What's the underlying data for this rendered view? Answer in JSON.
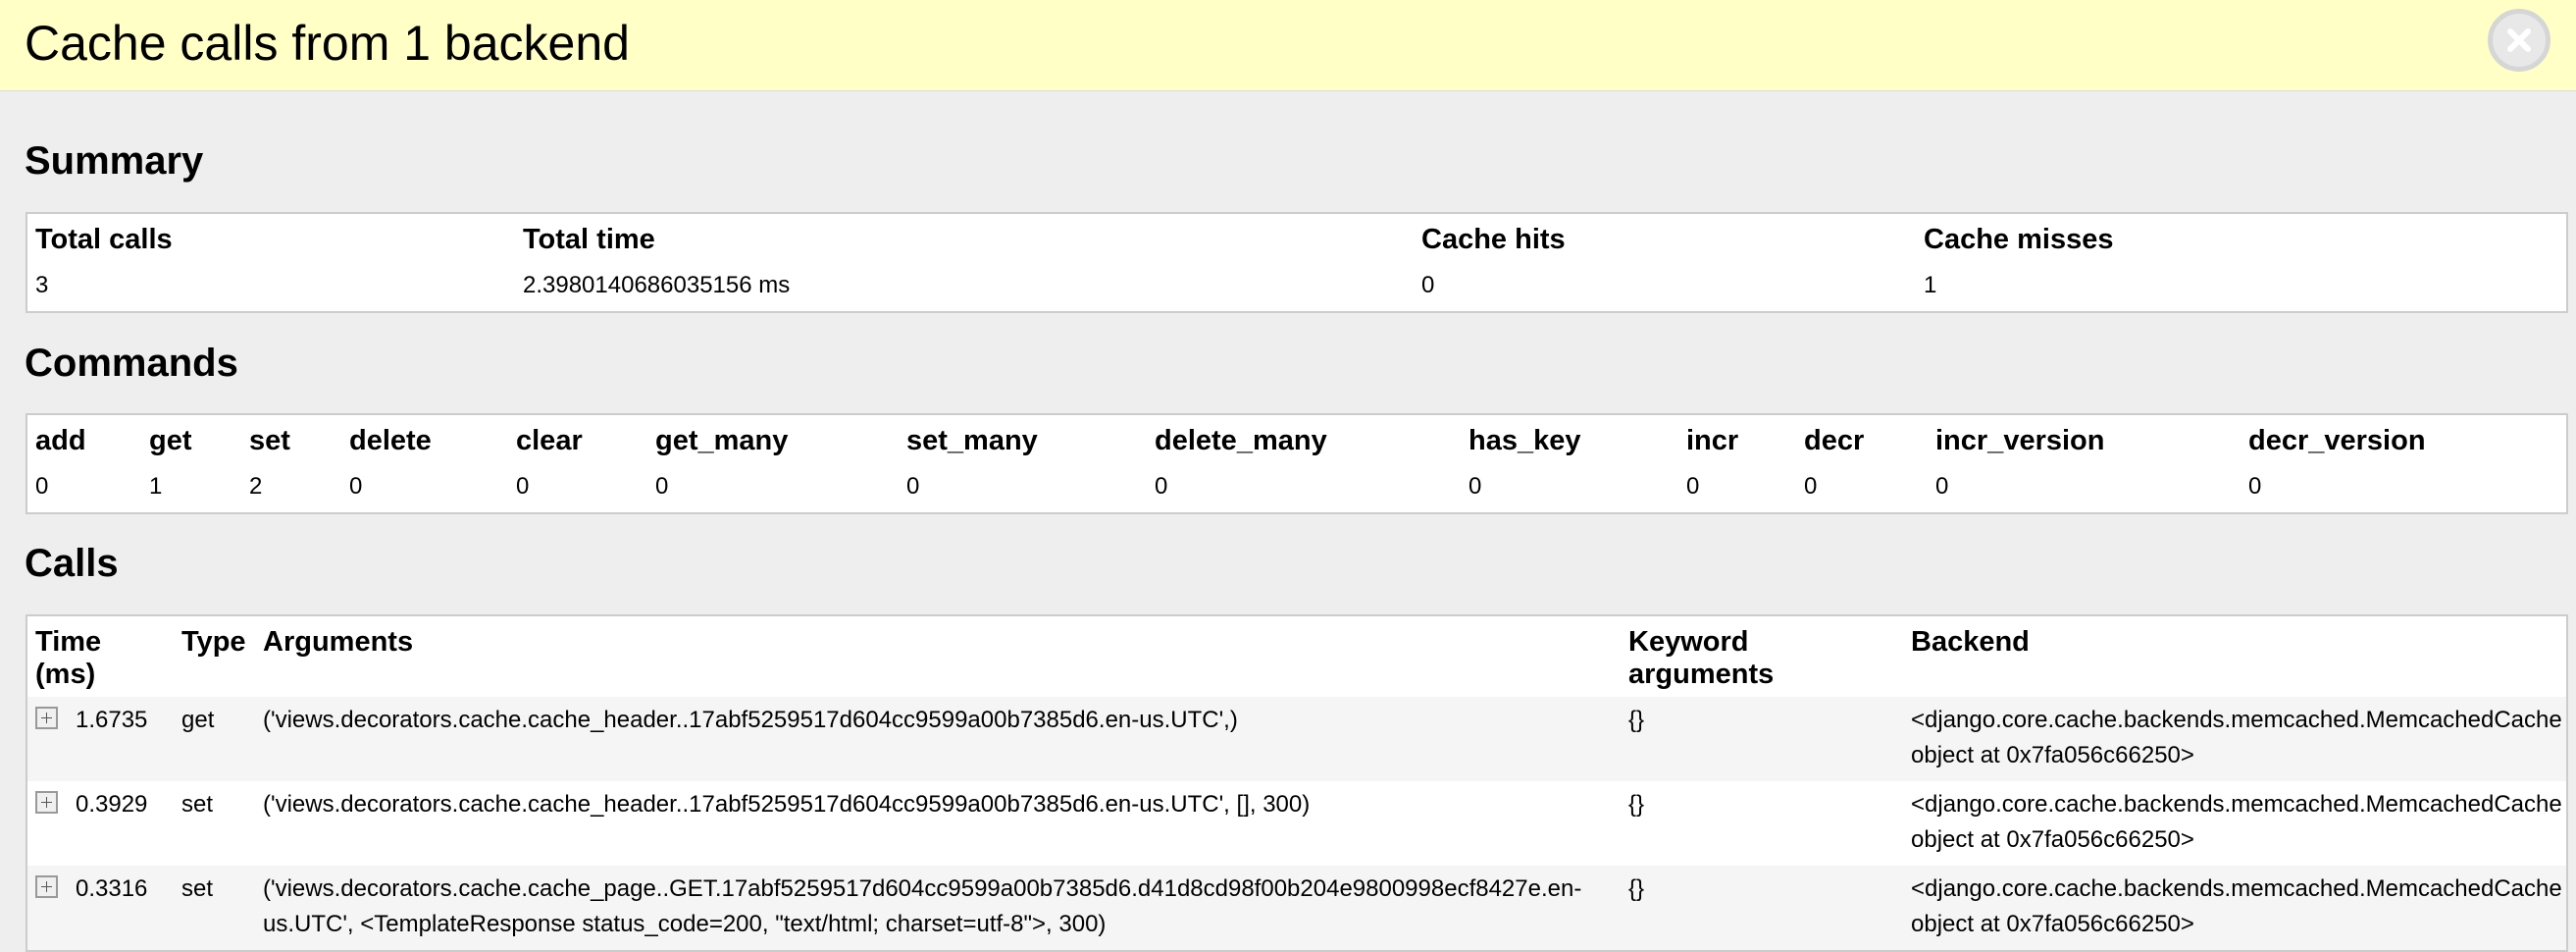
{
  "header": {
    "title": "Cache calls from 1 backend"
  },
  "summary": {
    "title": "Summary",
    "headers": [
      "Total calls",
      "Total time",
      "Cache hits",
      "Cache misses"
    ],
    "values": [
      "3",
      "2.3980140686035156 ms",
      "0",
      "1"
    ]
  },
  "commands": {
    "title": "Commands",
    "headers": [
      "add",
      "get",
      "set",
      "delete",
      "clear",
      "get_many",
      "set_many",
      "delete_many",
      "has_key",
      "incr",
      "decr",
      "incr_version",
      "decr_version"
    ],
    "values": [
      "0",
      "1",
      "2",
      "0",
      "0",
      "0",
      "0",
      "0",
      "0",
      "0",
      "0",
      "0",
      "0"
    ]
  },
  "calls": {
    "title": "Calls",
    "headers": [
      "Time (ms)",
      "Type",
      "Arguments",
      "Keyword arguments",
      "Backend"
    ],
    "rows": [
      {
        "time": "1.6735",
        "type": "get",
        "arguments": "('views.decorators.cache.cache_header..17abf5259517d604cc9599a00b7385d6.en-us.UTC',)",
        "kwargs": "{}",
        "backend": "<django.core.cache.backends.memcached.MemcachedCache object at 0x7fa056c66250>"
      },
      {
        "time": "0.3929",
        "type": "set",
        "arguments": "('views.decorators.cache.cache_header..17abf5259517d604cc9599a00b7385d6.en-us.UTC', [], 300)",
        "kwargs": "{}",
        "backend": "<django.core.cache.backends.memcached.MemcachedCache object at 0x7fa056c66250>"
      },
      {
        "time": "0.3316",
        "type": "set",
        "arguments": "('views.decorators.cache.cache_page..GET.17abf5259517d604cc9599a00b7385d6.d41d8cd98f00b204e9800998ecf8427e.en-us.UTC', <TemplateResponse status_code=200, \"text/html; charset=utf-8\">, 300)",
        "kwargs": "{}",
        "backend": "<django.core.cache.backends.memcached.MemcachedCache object at 0x7fa056c66250>"
      }
    ]
  },
  "icons": {
    "close": "close-icon",
    "toggle": "plus-icon"
  },
  "colors": {
    "header_bg": "#ffffc6",
    "page_bg": "#eeeeee",
    "table_border": "#cccccc",
    "row_alt": "#f5f5f5"
  }
}
